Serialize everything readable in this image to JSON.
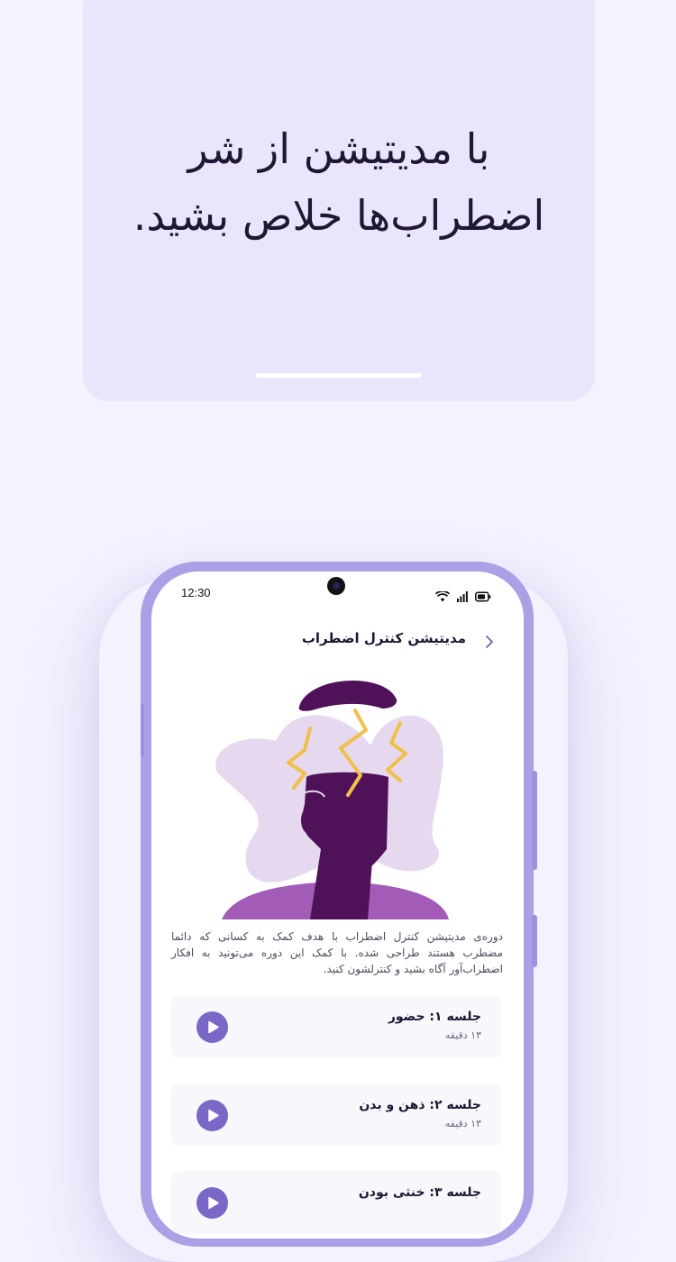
{
  "promo": {
    "headline_line1": "با مدیتیشن از شر",
    "headline_line2": "اضطراب‌ها خلاص بشید."
  },
  "status_bar": {
    "time": "12:30",
    "icons": [
      "wifi-icon",
      "signal-icon",
      "battery-icon"
    ]
  },
  "screen": {
    "title": "مدیتیشن کنترل اضطراب",
    "back_icon": "chevron-right-icon",
    "description": "دوره‌ی مدیتیشن کنترل اضطراب با هدف کمک به کسانی که دائما مضطرب هستند طراحی شده. با کمک این دوره می‌تونید به افکار اضطراب‌آور آگاه بشید و کنترلشون کنید."
  },
  "sessions": [
    {
      "title": "جلسه ۱: حضور",
      "duration": "۱۳ دقیقه"
    },
    {
      "title": "جلسه ۲: ذهن و بدن",
      "duration": "۱۳ دقیقه"
    },
    {
      "title": "جلسه ۳: خنثی بودن",
      "duration": ""
    }
  ],
  "colors": {
    "accent": "#7b68c6",
    "phone_frame": "#ad9fe6",
    "promo_card": "#e9e6fb",
    "illustration_dark": "#4f1158",
    "illustration_light": "#e6d9ef",
    "lightning": "#f0c04a"
  }
}
